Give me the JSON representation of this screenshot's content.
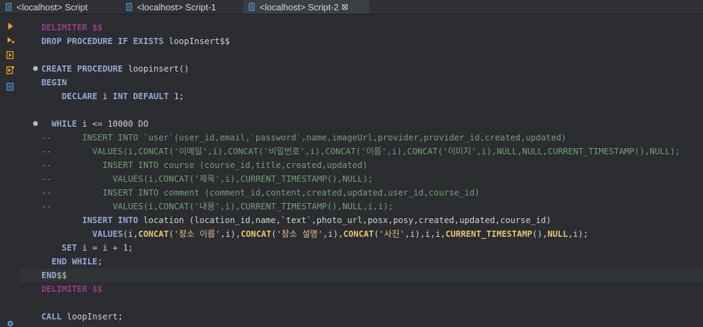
{
  "tabs": [
    {
      "label": "<localhost> Script",
      "active": false
    },
    {
      "label": "<localhost> Script-1",
      "active": false
    },
    {
      "label": "<localhost> Script-2",
      "active": true,
      "close": "⊠"
    }
  ],
  "gutter_icons": [
    "run-statement-icon",
    "run-statement-new-tab-icon",
    "execute-script-icon",
    "execute-script-new-tab-icon",
    "explain-plan-icon",
    "settings-icon"
  ],
  "editor": {
    "lines": [
      {
        "t": "DELIMITER $$",
        "k": "del"
      },
      {
        "segs": [
          [
            "kw",
            "DROP PROCEDURE IF EXISTS"
          ],
          [
            "",
            "loopInsert$$"
          ]
        ],
        "sp": [
          1
        ]
      },
      {
        "segs": [],
        "blank": true
      },
      {
        "segs": [
          [
            "kw",
            "CREATE PROCEDURE"
          ],
          [
            "",
            "loopinsert()"
          ]
        ],
        "sp": [
          1
        ],
        "fold": true
      },
      {
        "segs": [
          [
            "kw",
            "BEGIN"
          ]
        ]
      },
      {
        "segs": [
          [
            "",
            "    "
          ],
          [
            "kw",
            "DECLARE"
          ],
          [
            "",
            "i"
          ],
          [
            "kw",
            "INT DEFAULT"
          ],
          [
            "",
            "1;"
          ]
        ],
        "sp": [
          2,
          3,
          4
        ]
      },
      {
        "segs": [],
        "blank": true
      },
      {
        "segs": [
          [
            "",
            "  "
          ],
          [
            "kw",
            "WHILE"
          ],
          [
            "",
            "i <= 10000 DO"
          ]
        ],
        "sp": [
          2
        ],
        "fold": true
      },
      {
        "t": "--      INSERT INTO `user`(user_id,email,`password`,name,imageUrl,provider,provider_id,created,updated)",
        "k": "cm"
      },
      {
        "t": "--        VALUES(i,CONCAT('이메일',i),CONCAT('비밀번호',i),CONCAT('이름',i),CONCAT('이미지',i),NULL,NULL,CURRENT_TIMESTAMP(),NULL);",
        "k": "cm"
      },
      {
        "t": "--          INSERT INTO course (course_id,title,created,updated)",
        "k": "cm"
      },
      {
        "t": "--            VALUES(i,CONCAT('제목',i),CURRENT_TIMESTAMP(),NULL);",
        "k": "cm"
      },
      {
        "t": "--          INSERT INTO comment (comment_id,content,created,updated,user_id,course_id)",
        "k": "cm"
      },
      {
        "t": "--            VALUES(i,CONCAT('내용',i),CURRENT_TIMESTAMP(),NULL,i,i);",
        "k": "cm"
      },
      {
        "segs": [
          [
            "",
            "        "
          ],
          [
            "kw",
            "INSERT INTO"
          ],
          [
            "",
            "location (location_id,name,`text`,photo_url,posx,posy,created,updated,course_id)"
          ]
        ],
        "sp": [
          2
        ]
      },
      {
        "segs": [
          [
            "",
            "          "
          ],
          [
            "kw",
            "VALUES"
          ],
          [
            "",
            "(i,"
          ],
          [
            "gold",
            "CONCAT"
          ],
          [
            "",
            "("
          ],
          [
            "str",
            "'장소 이름'"
          ],
          [
            "",
            ",i),"
          ],
          [
            "gold",
            "CONCAT"
          ],
          [
            "",
            "("
          ],
          [
            "str",
            "'장소 설명'"
          ],
          [
            "",
            ",i),"
          ],
          [
            "gold",
            "CONCAT"
          ],
          [
            "",
            "("
          ],
          [
            "str",
            "'사진'"
          ],
          [
            "",
            ",i),i,i,"
          ],
          [
            "gold",
            "CURRENT_TIMESTAMP"
          ],
          [
            "",
            "(),"
          ],
          [
            "gold",
            "NULL"
          ],
          [
            "",
            ",i);"
          ]
        ]
      },
      {
        "segs": [
          [
            "",
            "    "
          ],
          [
            "kw",
            "SET"
          ],
          [
            "",
            "i = i + 1;"
          ]
        ],
        "sp": [
          2
        ]
      },
      {
        "segs": [
          [
            "",
            "  "
          ],
          [
            "kw",
            "END WHILE"
          ],
          [
            "",
            ";"
          ]
        ]
      },
      {
        "segs": [
          [
            "kw",
            "END"
          ],
          [
            "",
            "$$"
          ]
        ],
        "current": true
      },
      {
        "t": "DELIMITER $$",
        "k": "del"
      },
      {
        "segs": [],
        "blank": true
      },
      {
        "segs": [
          [
            "kw",
            "CALL"
          ],
          [
            "",
            "loopInsert;"
          ]
        ],
        "sp": [
          1
        ]
      }
    ]
  }
}
